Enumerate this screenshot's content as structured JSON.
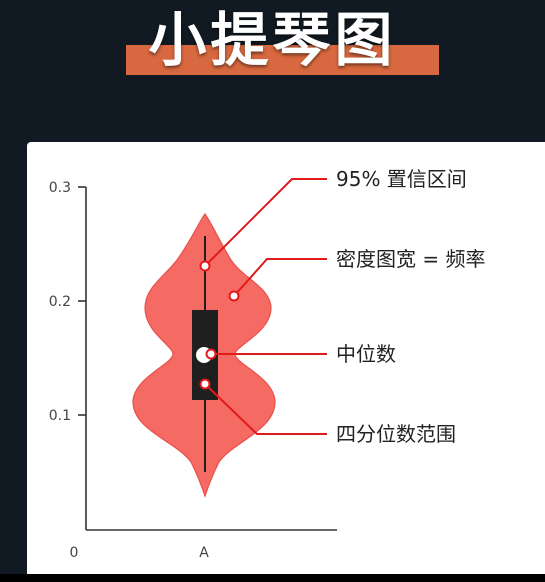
{
  "title": "小提琴图",
  "colors": {
    "background": "#111a22",
    "title_bar": "#d8683f",
    "violin_fill": "#f56a63",
    "violin_stroke": "#e8514a",
    "box": "#1f1f1f",
    "annotation": "#e11b1b",
    "axis": "#333333"
  },
  "axis": {
    "y_ticks": [
      "0.3",
      "0.2",
      "0.1"
    ],
    "origin": "0",
    "x_category": "A"
  },
  "annotations": {
    "ci": "95% 置信区间",
    "density": "密度图宽 = 频率",
    "median": "中位数",
    "iqr": "四分位数范围"
  }
}
